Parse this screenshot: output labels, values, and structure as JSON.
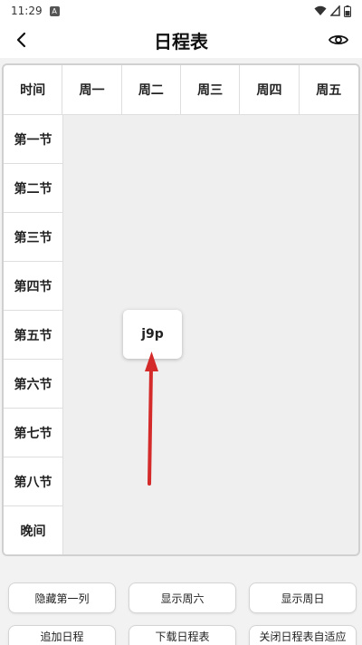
{
  "status": {
    "time": "11:29"
  },
  "header": {
    "title": "日程表"
  },
  "timetable": {
    "header": [
      "时间",
      "周一",
      "周二",
      "周三",
      "周四",
      "周五"
    ],
    "periods": [
      "第一节",
      "第二节",
      "第三节",
      "第四节",
      "第五节",
      "第六节",
      "第七节",
      "第八节",
      "晚间"
    ],
    "course": {
      "label": "j9p",
      "day": "周二",
      "period": "第五节"
    }
  },
  "annotation": {
    "arrow_color": "#d42a2a"
  },
  "buttons": {
    "hide_first_col": "隐藏第一列",
    "show_sat": "显示周六",
    "show_sun": "显示周日",
    "add_schedule": "追加日程",
    "download_schedule": "下载日程表",
    "close_autofit": "关闭日程表自适应"
  }
}
